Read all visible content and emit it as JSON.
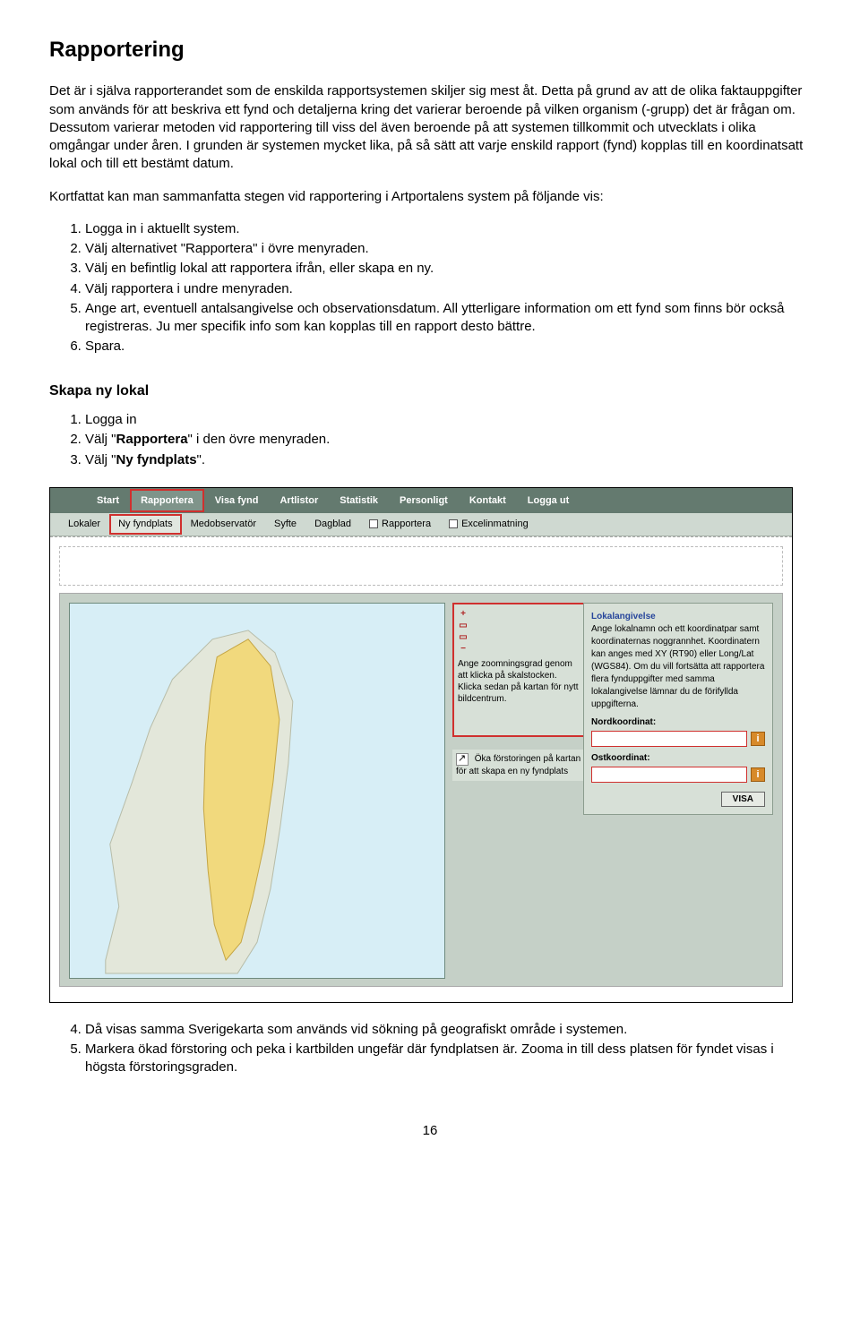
{
  "heading": "Rapportering",
  "para1": "Det är i själva rapporterandet som de enskilda rapportsystemen skiljer sig mest åt. Detta på grund av att de olika faktauppgifter som används för att beskriva ett fynd och detaljerna kring det varierar beroende på vilken organism (-grupp) det är frågan om. Dessutom varierar metoden vid rapportering till viss del även beroende på att systemen tillkommit och utvecklats i olika omgångar under åren. I grunden är systemen mycket lika, på så sätt att varje enskild rapport (fynd) kopplas till en koordinatsatt lokal och till ett bestämt datum.",
  "para2": "Kortfattat kan man sammanfatta stegen vid rapportering i Artportalens system på följande vis:",
  "steps1": [
    "Logga in i aktuellt system.",
    "Välj alternativet \"Rapportera\" i övre menyraden.",
    "Välj en befintlig lokal att rapportera ifrån, eller skapa en ny.",
    "Välj rapportera i undre menyraden.",
    "Ange art, eventuell antalsangivelse och observationsdatum. All ytterligare information om ett fynd som finns bör också registreras. Ju mer specifik info som kan kopplas till en rapport desto bättre.",
    "Spara."
  ],
  "sub1": "Skapa ny lokal",
  "steps2_pre": "Logga in",
  "steps2_2a": "Välj \"",
  "steps2_2b": "Rapportera",
  "steps2_2c": "\" i den övre menyraden.",
  "steps2_3a": "Välj \"",
  "steps2_3b": "Ny fyndplats",
  "steps2_3c": "\".",
  "nav": {
    "items": [
      "Start",
      "Rapportera",
      "Visa fynd",
      "Artlistor",
      "Statistik",
      "Personligt",
      "Kontakt",
      "Logga ut"
    ]
  },
  "subnav": {
    "items": [
      "Lokaler",
      "Ny fyndplats",
      "Medobservatör",
      "Syfte",
      "Dagblad",
      "Rapportera",
      "Excelinmatning"
    ]
  },
  "callout1": "Ange zoomningsgrad genom att klicka på skalstocken. Klicka sedan på kartan för nytt bildcentrum.",
  "callout2": "Öka förstoringen på kartan för att skapa en ny fyndplats",
  "form": {
    "title": "Lokalangivelse",
    "text": "Ange lokalnamn och ett koordinatpar samt koordinaternas noggrannhet. Koordinatern kan anges med XY (RT90) eller Long/Lat (WGS84). Om du vill fortsätta att rapportera flera fynduppgifter med samma lokalangivelse lämnar du de förifyllda uppgifterna.",
    "f1": "Nordkoordinat:",
    "f2": "Ostkoordinat:",
    "btn": "VISA"
  },
  "after": [
    "Då visas samma Sverigekarta som används vid sökning på geografiskt område i systemen.",
    "Markera ökad förstoring och peka i kartbilden ungefär där fyndplatsen är. Zooma in till dess platsen för fyndet visas i högsta förstoringsgraden."
  ],
  "page": "16"
}
